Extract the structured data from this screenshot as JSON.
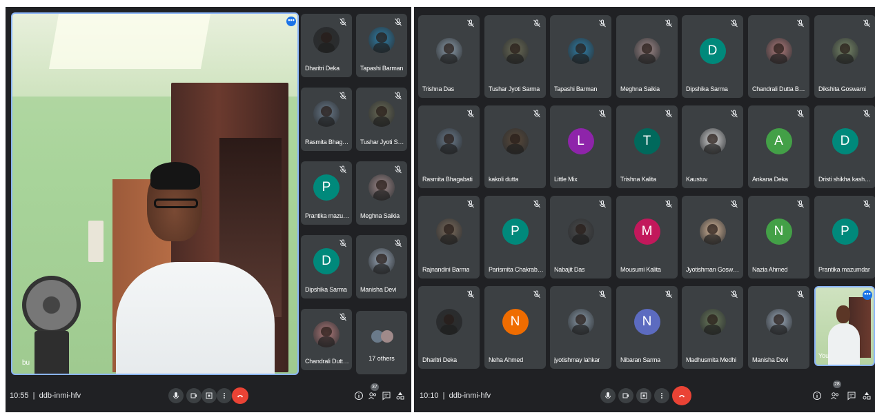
{
  "left": {
    "presenter_name": "bu",
    "tiles": [
      {
        "name": "Dharitri Deka",
        "avatar": "photo",
        "color": "#2b2b2b"
      },
      {
        "name": "Tapashi Barman",
        "avatar": "photo",
        "color": "#2e7fa8"
      },
      {
        "name": "Rasmita Bhagabati",
        "avatar": "photo",
        "color": "#6a7a8a"
      },
      {
        "name": "Tushar Jyoti Sarma",
        "avatar": "photo",
        "color": "#6b6b55"
      },
      {
        "name": "Prantika mazumdar",
        "avatar": "letter",
        "letter": "P",
        "color": "#00897b"
      },
      {
        "name": "Meghna Saikia",
        "avatar": "photo",
        "color": "#a08a8a"
      },
      {
        "name": "Dipshika Sarma",
        "avatar": "letter",
        "letter": "D",
        "color": "#00897b"
      },
      {
        "name": "Manisha Devi",
        "avatar": "photo",
        "color": "#9aa8b8"
      },
      {
        "name": "Chandrali Dutta Baru...",
        "avatar": "photo",
        "color": "#b07a7a"
      }
    ],
    "others_label": "17 others",
    "bar": {
      "time": "10:55",
      "meeting_code": "ddb-inmi-hfv",
      "participant_count": "37"
    }
  },
  "right": {
    "tiles": [
      {
        "name": "Trishna Das",
        "avatar": "photo",
        "color": "#8a9aa8"
      },
      {
        "name": "Tushar Jyoti Sarma",
        "avatar": "photo",
        "color": "#6b6b55"
      },
      {
        "name": "Tapashi Barman",
        "avatar": "photo",
        "color": "#2e7fa8"
      },
      {
        "name": "Meghna Saikia",
        "avatar": "photo",
        "color": "#a08a8a"
      },
      {
        "name": "Dipshika Sarma",
        "avatar": "letter",
        "letter": "D",
        "color": "#00897b"
      },
      {
        "name": "Chandrali Dutta Baruah",
        "avatar": "photo",
        "color": "#b07a7a"
      },
      {
        "name": "Dikshita Goswami",
        "avatar": "photo",
        "color": "#7a8a6a"
      },
      {
        "name": "Rasmita Bhagabati",
        "avatar": "photo",
        "color": "#6a7a8a"
      },
      {
        "name": "kakoli dutta",
        "avatar": "photo",
        "color": "#5a4a3a"
      },
      {
        "name": "Little Mix",
        "avatar": "letter",
        "letter": "L",
        "color": "#8e24aa"
      },
      {
        "name": "Trishna Kalita",
        "avatar": "letter",
        "letter": "T",
        "color": "#00695c"
      },
      {
        "name": "Kaustuv",
        "avatar": "photo",
        "color": "#d8d8d8"
      },
      {
        "name": "Ankana Deka",
        "avatar": "letter",
        "letter": "A",
        "color": "#43a047"
      },
      {
        "name": "Dristi shikha kashyap",
        "avatar": "letter",
        "letter": "D",
        "color": "#00897b"
      },
      {
        "name": "Rajnandini Barma",
        "avatar": "photo",
        "color": "#7a6a5a"
      },
      {
        "name": "Parismita Chakrabarty",
        "avatar": "letter",
        "letter": "P",
        "color": "#00897b"
      },
      {
        "name": "Nabajit Das",
        "avatar": "photo",
        "color": "#4a4a4a"
      },
      {
        "name": "Mousumi Kalita",
        "avatar": "letter",
        "letter": "M",
        "color": "#c2185b"
      },
      {
        "name": "Jyotishman Goswami",
        "avatar": "photo",
        "color": "#d8b89a"
      },
      {
        "name": "Nazia Ahmed",
        "avatar": "letter",
        "letter": "N",
        "color": "#43a047"
      },
      {
        "name": "Prantika mazumdar",
        "avatar": "letter",
        "letter": "P",
        "color": "#00897b"
      },
      {
        "name": "Dharitri Deka",
        "avatar": "photo",
        "color": "#2b2b2b"
      },
      {
        "name": "Neha Ahmed",
        "avatar": "letter",
        "letter": "N",
        "color": "#ef6c00"
      },
      {
        "name": "jyotishmay lahkar",
        "avatar": "photo",
        "color": "#8a9aa8"
      },
      {
        "name": "Nibaran Sarma",
        "avatar": "letter",
        "letter": "N",
        "color": "#5c6bc0"
      },
      {
        "name": "Madhusmita Medhi",
        "avatar": "photo",
        "color": "#6a7a5a"
      },
      {
        "name": "Manisha Devi",
        "avatar": "photo",
        "color": "#9aa8b8"
      }
    ],
    "self_label": "You",
    "bar": {
      "time": "10:10",
      "meeting_code": "ddb-inmi-hfv",
      "participant_count": "28"
    }
  },
  "colors": {
    "background": "#202124",
    "tile": "#3c4043",
    "end_call": "#ea4335",
    "active_border": "#8ab4f8"
  }
}
